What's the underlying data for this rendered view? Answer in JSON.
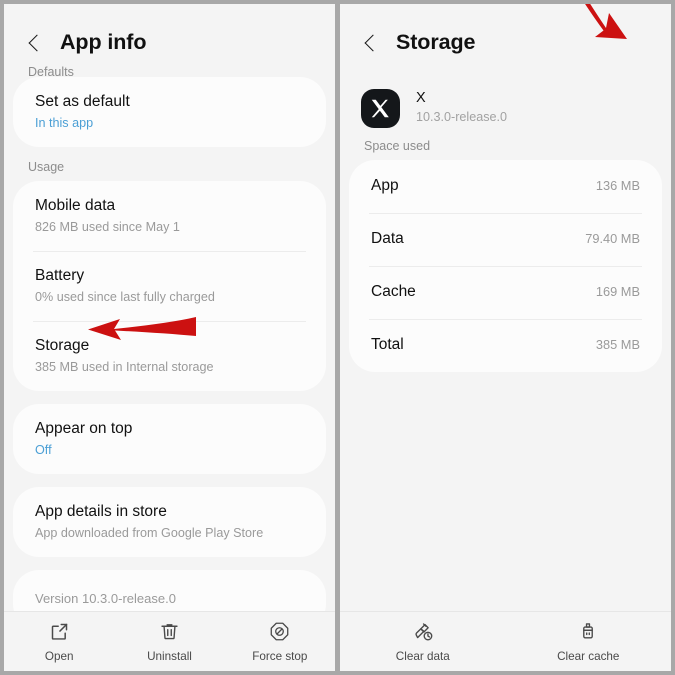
{
  "theme": {
    "page_bg": "#a8a8a8",
    "panel_bg": "#f4f4f4",
    "card_bg": "#fcfcfc",
    "accent_link": "#4b9fd5",
    "arrow_red": "#cc1111",
    "app_icon_bg": "#14171a"
  },
  "left_panel": {
    "header": {
      "back_icon": "chevron-left-icon",
      "title": "App info"
    },
    "sections": [
      {
        "label": "Defaults"
      },
      {
        "label": "Usage"
      }
    ],
    "defaults_card": {
      "rows": [
        {
          "title": "Set as default",
          "sub": "In this app",
          "sub_is_link": true
        }
      ]
    },
    "usage_card": {
      "rows": [
        {
          "title": "Mobile data",
          "sub": "826 MB used since May 1"
        },
        {
          "title": "Battery",
          "sub": "0% used since last fully charged"
        },
        {
          "title": "Storage",
          "sub": "385 MB used in Internal storage"
        }
      ]
    },
    "appear_card": {
      "rows": [
        {
          "title": "Appear on top",
          "sub": "Off",
          "sub_is_link": true
        }
      ]
    },
    "store_card": {
      "rows": [
        {
          "title": "App details in store",
          "sub": "App downloaded from Google Play Store"
        }
      ]
    },
    "version_card": {
      "text": "Version 10.3.0-release.0"
    },
    "bottom_bar": [
      {
        "icon": "open-external-icon",
        "label": "Open"
      },
      {
        "icon": "trash-icon",
        "label": "Uninstall"
      },
      {
        "icon": "force-stop-icon",
        "label": "Force stop"
      }
    ]
  },
  "right_panel": {
    "header": {
      "back_icon": "chevron-left-icon",
      "title": "Storage"
    },
    "app": {
      "icon": "x-app-icon",
      "name": "X",
      "version": "10.3.0-release.0"
    },
    "space_used_label": "Space used",
    "storage_rows": [
      {
        "label": "App",
        "value": "136 MB"
      },
      {
        "label": "Data",
        "value": "79.40 MB"
      },
      {
        "label": "Cache",
        "value": "169 MB"
      },
      {
        "label": "Total",
        "value": "385 MB"
      }
    ],
    "bottom_bar": [
      {
        "icon": "clear-data-icon",
        "label": "Clear data"
      },
      {
        "icon": "clear-cache-icon",
        "label": "Clear cache"
      }
    ]
  },
  "annotations": [
    {
      "name": "arrow-pointing-to-storage",
      "direction": "left"
    },
    {
      "name": "arrow-pointing-to-clear-cache",
      "direction": "down-right"
    }
  ]
}
